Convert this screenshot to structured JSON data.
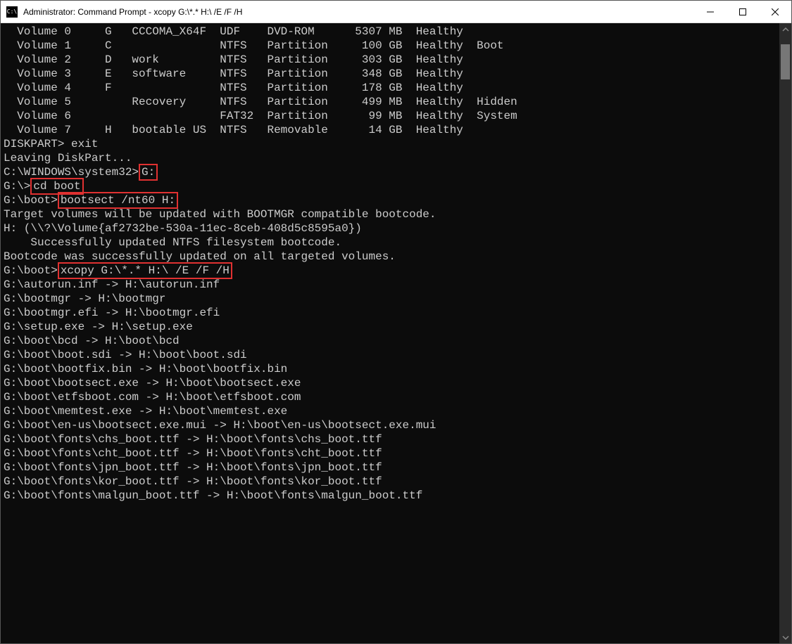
{
  "window": {
    "title": "Administrator: Command Prompt - xcopy  G:\\*.* H:\\ /E /F /H"
  },
  "volumes": [
    {
      "id": "Volume 0",
      "ltr": "G",
      "label": "CCCOMA_X64F",
      "fs": "UDF",
      "type": "DVD-ROM",
      "size": "5307 MB",
      "status": "Healthy",
      "info": ""
    },
    {
      "id": "Volume 1",
      "ltr": "C",
      "label": "",
      "fs": "NTFS",
      "type": "Partition",
      "size": "100 GB",
      "status": "Healthy",
      "info": "Boot"
    },
    {
      "id": "Volume 2",
      "ltr": "D",
      "label": "work",
      "fs": "NTFS",
      "type": "Partition",
      "size": "303 GB",
      "status": "Healthy",
      "info": ""
    },
    {
      "id": "Volume 3",
      "ltr": "E",
      "label": "software",
      "fs": "NTFS",
      "type": "Partition",
      "size": "348 GB",
      "status": "Healthy",
      "info": ""
    },
    {
      "id": "Volume 4",
      "ltr": "F",
      "label": "",
      "fs": "NTFS",
      "type": "Partition",
      "size": "178 GB",
      "status": "Healthy",
      "info": ""
    },
    {
      "id": "Volume 5",
      "ltr": "",
      "label": "Recovery",
      "fs": "NTFS",
      "type": "Partition",
      "size": "499 MB",
      "status": "Healthy",
      "info": "Hidden"
    },
    {
      "id": "Volume 6",
      "ltr": "",
      "label": "",
      "fs": "FAT32",
      "type": "Partition",
      "size": "99 MB",
      "status": "Healthy",
      "info": "System"
    },
    {
      "id": "Volume 7",
      "ltr": "H",
      "label": "bootable US",
      "fs": "NTFS",
      "type": "Removable",
      "size": "14 GB",
      "status": "Healthy",
      "info": ""
    }
  ],
  "lines": {
    "diskpart_prompt": "DISKPART> exit",
    "leaving": "Leaving DiskPart...",
    "sys32_prompt": "C:\\WINDOWS\\system32>",
    "cmd_g": "G:",
    "g_prompt": "G:\\>",
    "cmd_cd_boot": "cd boot",
    "gboot_prompt": "G:\\boot>",
    "cmd_bootsect": "bootsect /nt60 H:",
    "target_msg": "Target volumes will be updated with BOOTMGR compatible bootcode.",
    "h_volume": "H: (\\\\?\\Volume{af2732be-530a-11ec-8ceb-408d5c8595a0})",
    "success_ntfs": "    Successfully updated NTFS filesystem bootcode.",
    "bootcode_updated": "Bootcode was successfully updated on all targeted volumes.",
    "cmd_xcopy": "xcopy G:\\*.* H:\\ /E /F /H",
    "copy": [
      "G:\\autorun.inf -> H:\\autorun.inf",
      "G:\\bootmgr -> H:\\bootmgr",
      "G:\\bootmgr.efi -> H:\\bootmgr.efi",
      "G:\\setup.exe -> H:\\setup.exe",
      "G:\\boot\\bcd -> H:\\boot\\bcd",
      "G:\\boot\\boot.sdi -> H:\\boot\\boot.sdi",
      "G:\\boot\\bootfix.bin -> H:\\boot\\bootfix.bin",
      "G:\\boot\\bootsect.exe -> H:\\boot\\bootsect.exe",
      "G:\\boot\\etfsboot.com -> H:\\boot\\etfsboot.com",
      "G:\\boot\\memtest.exe -> H:\\boot\\memtest.exe",
      "G:\\boot\\en-us\\bootsect.exe.mui -> H:\\boot\\en-us\\bootsect.exe.mui",
      "G:\\boot\\fonts\\chs_boot.ttf -> H:\\boot\\fonts\\chs_boot.ttf",
      "G:\\boot\\fonts\\cht_boot.ttf -> H:\\boot\\fonts\\cht_boot.ttf",
      "G:\\boot\\fonts\\jpn_boot.ttf -> H:\\boot\\fonts\\jpn_boot.ttf",
      "G:\\boot\\fonts\\kor_boot.ttf -> H:\\boot\\fonts\\kor_boot.ttf",
      "G:\\boot\\fonts\\malgun_boot.ttf -> H:\\boot\\fonts\\malgun_boot.ttf"
    ]
  }
}
